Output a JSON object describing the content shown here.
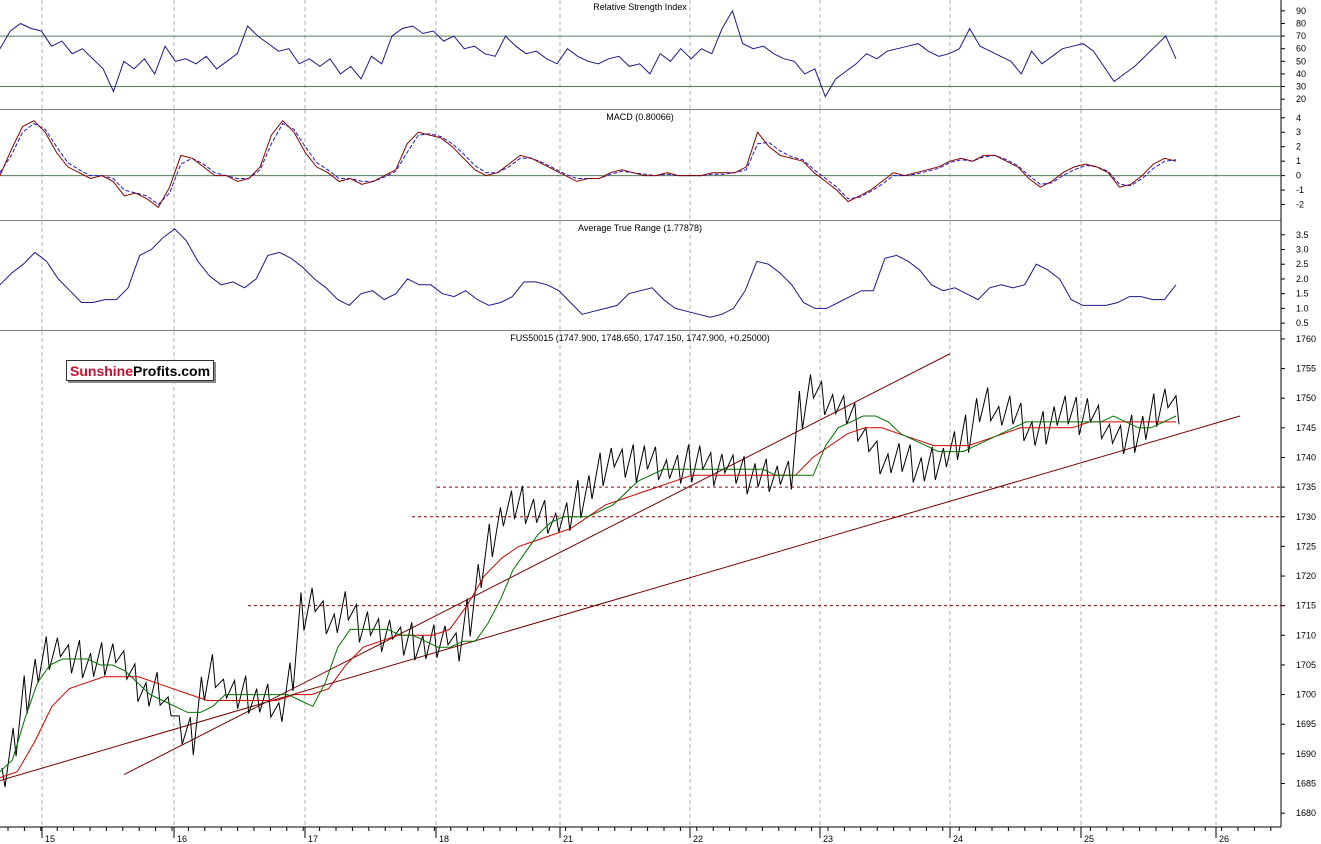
{
  "chart_data": [
    {
      "type": "line",
      "title": "Relative Strength Index",
      "yticks": [
        20,
        30,
        40,
        50,
        60,
        70,
        80,
        90
      ],
      "ylim": [
        13,
        97
      ],
      "reference_lines": [
        30,
        70
      ],
      "series": [
        {
          "values": [
            60,
            74,
            80,
            76,
            74,
            62,
            66,
            56,
            60,
            52,
            44,
            26,
            50,
            44,
            52,
            40,
            62,
            50,
            52,
            48,
            54,
            44,
            50,
            56,
            78,
            70,
            64,
            58,
            60,
            48,
            52,
            46,
            52,
            40,
            46,
            36,
            54,
            48,
            70,
            76,
            78,
            72,
            74,
            66,
            70,
            60,
            62,
            56,
            54,
            70,
            62,
            56,
            58,
            52,
            48,
            60,
            54,
            50,
            48,
            52,
            54,
            46,
            48,
            40,
            56,
            50,
            60,
            52,
            60,
            56,
            76,
            90,
            64,
            60,
            62,
            56,
            52,
            50,
            40,
            44,
            22,
            36,
            42,
            48,
            56,
            52,
            58,
            60,
            62,
            64,
            58,
            54,
            56,
            60,
            76,
            62,
            58,
            54,
            50,
            40,
            58,
            48,
            54,
            60,
            62,
            64,
            58,
            46,
            34,
            40,
            46,
            54,
            62,
            70,
            52
          ]
        }
      ]
    },
    {
      "type": "line",
      "title": "MACD (0.80066)",
      "yticks": [
        -2,
        -1,
        0,
        1,
        2,
        3,
        4
      ],
      "ylim": [
        -3,
        4.4
      ],
      "reference_lines": [
        0
      ],
      "series": [
        {
          "values": [
            0,
            1.8,
            3.4,
            3.8,
            3,
            1.6,
            0.6,
            0.2,
            -0.2,
            0,
            -0.4,
            -1.4,
            -1.2,
            -1.6,
            -2.2,
            -0.8,
            1.4,
            1.2,
            0.6,
            0,
            0,
            -0.4,
            -0.2,
            0.6,
            2.8,
            3.8,
            3,
            1.6,
            0.6,
            0.2,
            -0.4,
            -0.2,
            -0.6,
            -0.4,
            0,
            0.4,
            2.2,
            3,
            2.8,
            2.6,
            2,
            1.2,
            0.4,
            0,
            0.2,
            0.8,
            1.4,
            1.2,
            0.8,
            0.4,
            0,
            -0.4,
            -0.2,
            -0.2,
            0.2,
            0.4,
            0.2,
            0,
            0,
            0.2,
            0,
            0,
            0,
            0.2,
            0.2,
            0.2,
            0.6,
            3,
            2,
            1.4,
            1.2,
            1,
            0.2,
            -0.4,
            -1,
            -1.8,
            -1.4,
            -1,
            -0.4,
            0.2,
            0,
            0.2,
            0.4,
            0.6,
            1,
            1.2,
            1,
            1.4,
            1.4,
            1,
            0.6,
            -0.2,
            -0.8,
            -0.4,
            0.2,
            0.6,
            0.8,
            0.6,
            0.2,
            -0.8,
            -0.6,
            0,
            0.8,
            1.2,
            1
          ]
        },
        {
          "values": [
            0.2,
            1.4,
            3,
            3.6,
            3.2,
            2,
            0.9,
            0.4,
            0,
            0,
            -0.2,
            -1,
            -1.2,
            -1.4,
            -2,
            -1.2,
            0.8,
            1.2,
            0.8,
            0.2,
            0,
            -0.2,
            -0.2,
            0.4,
            2.2,
            3.6,
            3.2,
            2,
            0.9,
            0.4,
            -0.2,
            -0.2,
            -0.4,
            -0.4,
            -0.1,
            0.3,
            1.6,
            2.8,
            2.9,
            2.7,
            2.2,
            1.5,
            0.7,
            0.2,
            0.2,
            0.6,
            1.2,
            1.2,
            0.9,
            0.5,
            0.1,
            -0.2,
            -0.2,
            -0.2,
            0.1,
            0.3,
            0.2,
            0.1,
            0,
            0.1,
            0,
            0,
            0,
            0.1,
            0.1,
            0.2,
            0.4,
            2.2,
            2.3,
            1.7,
            1.3,
            1.1,
            0.4,
            -0.2,
            -0.8,
            -1.6,
            -1.5,
            -1.1,
            -0.6,
            0,
            0,
            0.1,
            0.3,
            0.5,
            0.9,
            1.1,
            1,
            1.3,
            1.4,
            1.1,
            0.7,
            0,
            -0.6,
            -0.5,
            0,
            0.4,
            0.7,
            0.6,
            0.3,
            -0.6,
            -0.7,
            -0.2,
            0.5,
            1,
            1.1
          ]
        }
      ]
    },
    {
      "type": "line",
      "title": "Average True Range (1.77878)",
      "yticks": [
        0.5,
        1.0,
        1.5,
        2.0,
        2.5,
        3.0,
        3.5
      ],
      "ylim": [
        0.3,
        3.9
      ],
      "series": [
        {
          "values": [
            1.8,
            2.2,
            2.5,
            2.9,
            2.6,
            2,
            1.6,
            1.2,
            1.2,
            1.3,
            1.3,
            1.7,
            2.8,
            3,
            3.4,
            3.7,
            3.3,
            2.6,
            2.1,
            1.8,
            1.9,
            1.7,
            2,
            2.8,
            2.9,
            2.7,
            2.4,
            2,
            1.7,
            1.3,
            1.1,
            1.5,
            1.6,
            1.3,
            1.5,
            2,
            1.8,
            1.8,
            1.5,
            1.4,
            1.6,
            1.3,
            1.1,
            1.2,
            1.4,
            1.9,
            1.9,
            1.8,
            1.6,
            1.2,
            0.8,
            0.9,
            1,
            1.1,
            1.5,
            1.6,
            1.7,
            1.3,
            1,
            0.9,
            0.8,
            0.7,
            0.8,
            1,
            1.6,
            2.6,
            2.5,
            2.2,
            1.8,
            1.2,
            1,
            1,
            1.2,
            1.4,
            1.6,
            1.6,
            2.7,
            2.8,
            2.6,
            2.3,
            1.8,
            1.6,
            1.7,
            1.5,
            1.3,
            1.7,
            1.8,
            1.7,
            1.8,
            2.5,
            2.3,
            2,
            1.3,
            1.1,
            1.1,
            1.1,
            1.2,
            1.4,
            1.4,
            1.3,
            1.3,
            1.8
          ]
        }
      ]
    },
    {
      "type": "line",
      "title": "FUS50015 (1747.900, 1748.650, 1747.150, 1747.900, +0.25000)",
      "x_ticks": [
        "15",
        "16",
        "17",
        "18",
        "21",
        "22",
        "23",
        "24",
        "25",
        "26"
      ],
      "yticks": [
        1680,
        1685,
        1690,
        1695,
        1700,
        1705,
        1710,
        1715,
        1720,
        1725,
        1730,
        1735,
        1740,
        1745,
        1750,
        1755,
        1760
      ],
      "ylim": [
        1678,
        1761
      ],
      "support_levels": [
        1715,
        1730,
        1735
      ],
      "series": [
        {
          "values": [
            1686,
            1692,
            1700,
            1704,
            1707,
            1708,
            1706,
            1706,
            1705,
            1706,
            1707,
            1705,
            1702,
            1700,
            1701,
            1698,
            1694,
            1693,
            1701,
            1704,
            1701,
            1700,
            1700,
            1699,
            1699,
            1697,
            1703,
            1714,
            1716,
            1713,
            1712,
            1715,
            1712,
            1712,
            1710,
            1711,
            1709,
            1709,
            1708,
            1709,
            1710,
            1708,
            1713,
            1720,
            1726,
            1730,
            1732,
            1732,
            1731,
            1730,
            1729,
            1730,
            1733,
            1735,
            1738,
            1740,
            1739,
            1739,
            1740,
            1739,
            1738,
            1738,
            1739,
            1740,
            1738,
            1739,
            1738,
            1737,
            1737,
            1737,
            1737,
            1737,
            1748,
            1752,
            1750,
            1749,
            1748,
            1746,
            1743,
            1740,
            1739,
            1740,
            1739,
            1738,
            1739,
            1740,
            1742,
            1744,
            1748,
            1749,
            1747,
            1748,
            1746,
            1744,
            1745,
            1747,
            1748,
            1747,
            1748,
            1746,
            1744,
            1743,
            1744,
            1745,
            1748,
            1750,
            1748
          ]
        },
        {
          "values": [
            1687,
            1689,
            1696,
            1702,
            1705,
            1706,
            1706,
            1706,
            1705,
            1705,
            1704,
            1702,
            1700,
            1699,
            1698,
            1697,
            1697,
            1698,
            1700,
            1700,
            1700,
            1700,
            1700,
            1700,
            1699,
            1698,
            1702,
            1708,
            1711,
            1711,
            1711,
            1711,
            1710,
            1710,
            1709,
            1708,
            1708,
            1709,
            1709,
            1712,
            1716,
            1721,
            1724,
            1727,
            1729,
            1730,
            1730,
            1730,
            1731,
            1732,
            1734,
            1736,
            1737,
            1738,
            1738,
            1738,
            1738,
            1738,
            1738,
            1738,
            1738,
            1738,
            1737,
            1737,
            1737,
            1737,
            1742,
            1745,
            1746,
            1747,
            1747,
            1746,
            1744,
            1743,
            1742,
            1741,
            1741,
            1741,
            1742,
            1743,
            1744,
            1745,
            1746,
            1746,
            1746,
            1746,
            1746,
            1746,
            1746,
            1747,
            1746,
            1745,
            1745,
            1746,
            1747
          ]
        },
        {
          "values": [
            1686,
            1687,
            1692,
            1698,
            1701,
            1702,
            1703,
            1703,
            1703,
            1702,
            1701,
            1700,
            1699,
            1699,
            1699,
            1699,
            1699,
            1700,
            1700,
            1701,
            1705,
            1708,
            1709,
            1710,
            1710,
            1710,
            1711,
            1715,
            1720,
            1723,
            1725,
            1726,
            1727,
            1728,
            1730,
            1732,
            1733,
            1734,
            1735,
            1736,
            1737,
            1737,
            1737,
            1737,
            1737,
            1737,
            1737,
            1740,
            1742,
            1744,
            1745,
            1745,
            1744,
            1743,
            1742,
            1742,
            1742,
            1743,
            1744,
            1745,
            1745,
            1745,
            1745,
            1746,
            1746,
            1746,
            1746,
            1746,
            1746
          ]
        }
      ]
    }
  ],
  "logo": {
    "part1": "Sunshine",
    "part2": "Profits.com"
  }
}
